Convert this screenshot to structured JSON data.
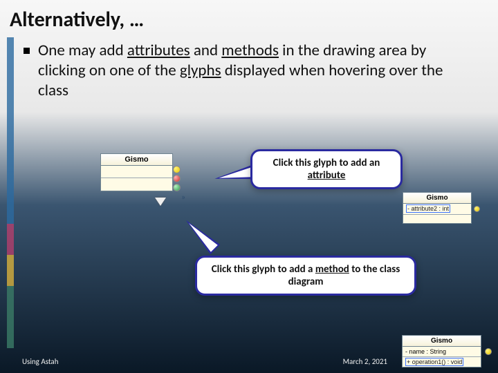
{
  "title": "Alternatively, …",
  "bullet": {
    "pre1": "One may add ",
    "attr": "attributes",
    "mid1": " and ",
    "meth": "methods",
    "mid2": " in the drawing area by clicking on one of the ",
    "glyphs": "glyphs",
    "post": " displayed when hovering over the class"
  },
  "uml1": {
    "name": "Gismo"
  },
  "uml2": {
    "name": "Gismo",
    "attr": "- attribute2 : int"
  },
  "uml3": {
    "name": "Gismo",
    "attr": "- name : String",
    "op": "+ operation1() : void"
  },
  "callout1": {
    "pre": "Click this glyph to add an ",
    "u": "attribute"
  },
  "callout2": {
    "pre": "Click this glyph to add a ",
    "u": "method",
    "post": " to the class diagram"
  },
  "footer": {
    "left": "Using Astah",
    "right": "March 2, 2021"
  }
}
